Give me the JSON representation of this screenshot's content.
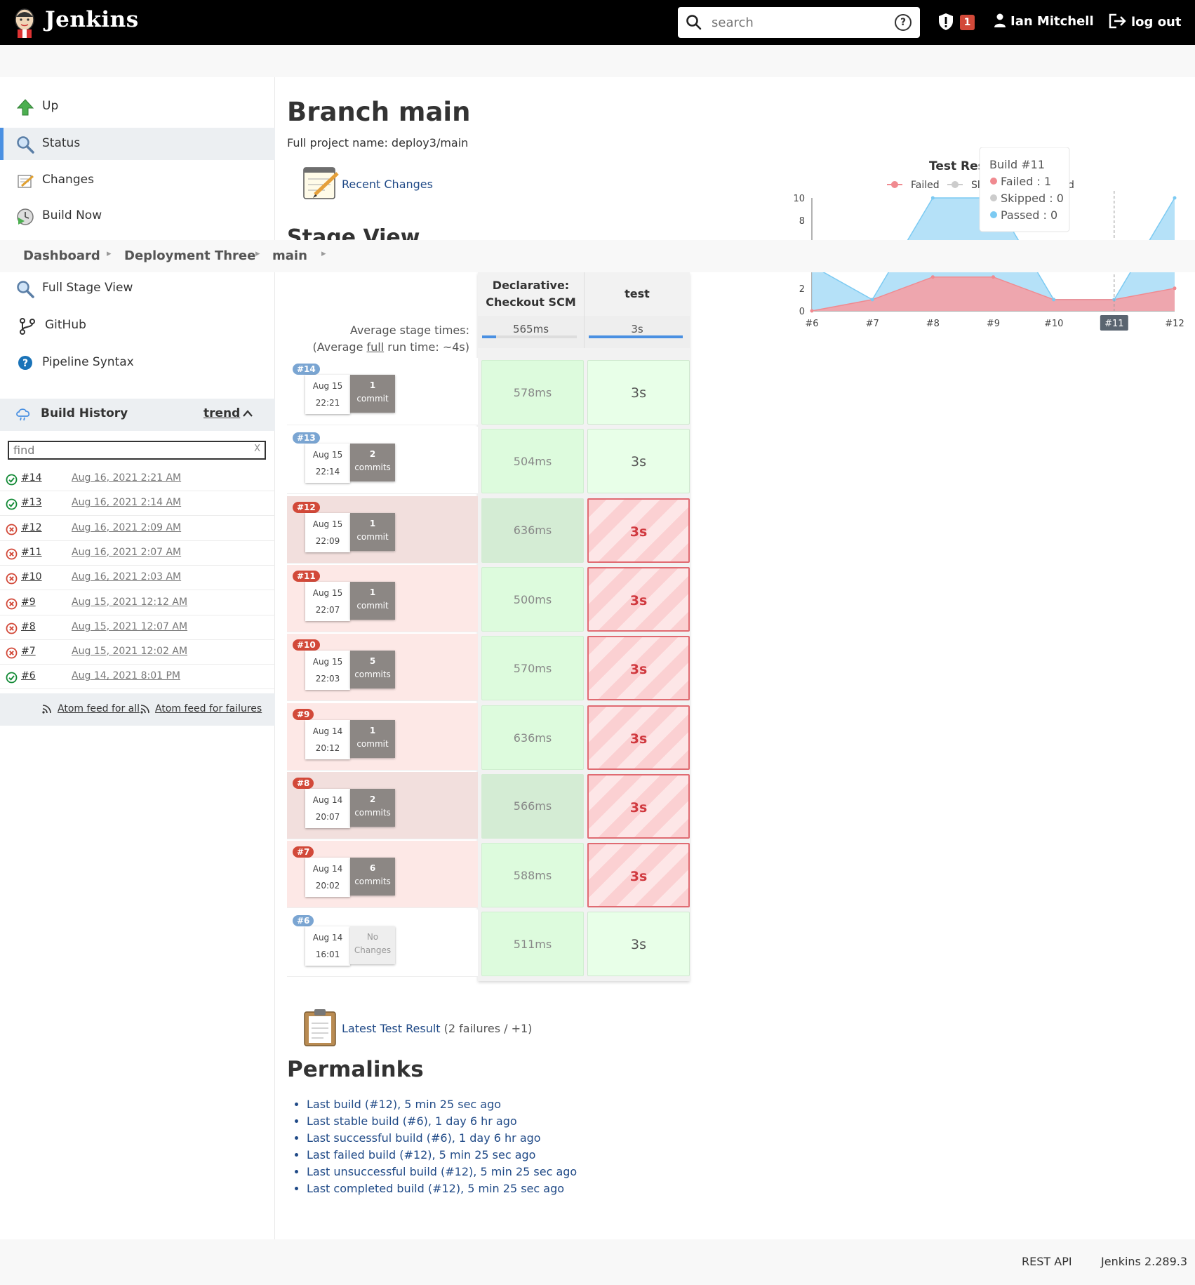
{
  "header": {
    "brand": "Jenkins",
    "search_placeholder": "search",
    "security_count": "1",
    "user_name": "Ian Mitchell",
    "logout_label": "log out"
  },
  "sidebar": {
    "tasks": [
      {
        "label": "Up",
        "icon": "up-arrow-icon"
      },
      {
        "label": "Status",
        "icon": "magnifier-icon"
      },
      {
        "label": "Changes",
        "icon": "notepad-icon"
      },
      {
        "label": "Build Now",
        "icon": "clock-play-icon"
      },
      {
        "label": "Full Stage View",
        "icon": "magnifier-icon"
      },
      {
        "label": "GitHub",
        "icon": "git-branch-icon"
      },
      {
        "label": "Pipeline Syntax",
        "icon": "help-icon"
      }
    ],
    "build_history": {
      "title": "Build History",
      "trend_label": "trend",
      "find_placeholder": "find",
      "clear_label": "X",
      "builds": [
        {
          "number": "#14",
          "date": "Aug 16, 2021 2:21 AM",
          "status": "success"
        },
        {
          "number": "#13",
          "date": "Aug 16, 2021 2:14 AM",
          "status": "success"
        },
        {
          "number": "#12",
          "date": "Aug 16, 2021 2:09 AM",
          "status": "failed"
        },
        {
          "number": "#11",
          "date": "Aug 16, 2021 2:07 AM",
          "status": "failed"
        },
        {
          "number": "#10",
          "date": "Aug 16, 2021 2:03 AM",
          "status": "failed"
        },
        {
          "number": "#9",
          "date": "Aug 15, 2021 12:12 AM",
          "status": "failed"
        },
        {
          "number": "#8",
          "date": "Aug 15, 2021 12:07 AM",
          "status": "failed"
        },
        {
          "number": "#7",
          "date": "Aug 15, 2021 12:02 AM",
          "status": "failed"
        },
        {
          "number": "#6",
          "date": "Aug 14, 2021 8:01 PM",
          "status": "success"
        }
      ],
      "atom_all": "Atom feed for all",
      "atom_failures": "Atom feed for failures"
    }
  },
  "breadcrumbs": [
    "Dashboard",
    "Deployment Three",
    "main"
  ],
  "main": {
    "title": "Branch main",
    "full_name": "Full project name: deploy3/main",
    "recent_changes": "Recent Changes",
    "stage_view_title": "Stage View",
    "latest_test_link": "Latest Test Result",
    "latest_test_suffix": " (2 failures / +1)",
    "permalinks_title": "Permalinks",
    "permalinks": [
      "Last build (#12), 5 min 25 sec ago",
      "Last stable build (#6), 1 day 6 hr ago",
      "Last successful build (#6), 1 day 6 hr ago",
      "Last failed build (#12), 5 min 25 sec ago",
      "Last unsuccessful build (#12), 5 min 25 sec ago",
      "Last completed build (#12), 5 min 25 sec ago"
    ]
  },
  "stage_view": {
    "stages": [
      "Declarative: Checkout SCM",
      "test"
    ],
    "avg_label": "Average stage times:",
    "avg_full_prefix": "(Average ",
    "avg_full_link": "full",
    "avg_full_suffix": " run time: ~4s)",
    "avg_times": [
      "565ms",
      "3s"
    ],
    "avg_fill": [
      0.15,
      1.0
    ],
    "failed_label": "failed",
    "runs": [
      {
        "badge": "#14",
        "date": "Aug 15",
        "time": "22:21",
        "commits_n": "1",
        "commits_w": "commit",
        "cells": [
          "578ms",
          "3s"
        ],
        "status": "success",
        "highlight": false
      },
      {
        "badge": "#13",
        "date": "Aug 15",
        "time": "22:14",
        "commits_n": "2",
        "commits_w": "commits",
        "cells": [
          "504ms",
          "3s"
        ],
        "status": "success",
        "highlight": false
      },
      {
        "badge": "#12",
        "date": "Aug 15",
        "time": "22:09",
        "commits_n": "1",
        "commits_w": "commit",
        "cells": [
          "636ms",
          "3s"
        ],
        "status": "failed",
        "highlight": true
      },
      {
        "badge": "#11",
        "date": "Aug 15",
        "time": "22:07",
        "commits_n": "1",
        "commits_w": "commit",
        "cells": [
          "500ms",
          "3s"
        ],
        "status": "failed",
        "highlight": false
      },
      {
        "badge": "#10",
        "date": "Aug 15",
        "time": "22:03",
        "commits_n": "5",
        "commits_w": "commits",
        "cells": [
          "570ms",
          "3s"
        ],
        "status": "failed",
        "highlight": false
      },
      {
        "badge": "#9",
        "date": "Aug 14",
        "time": "20:12",
        "commits_n": "1",
        "commits_w": "commit",
        "cells": [
          "636ms",
          "3s"
        ],
        "status": "failed",
        "highlight": false
      },
      {
        "badge": "#8",
        "date": "Aug 14",
        "time": "20:07",
        "commits_n": "2",
        "commits_w": "commits",
        "cells": [
          "566ms",
          "3s"
        ],
        "status": "failed",
        "highlight": true
      },
      {
        "badge": "#7",
        "date": "Aug 14",
        "time": "20:02",
        "commits_n": "6",
        "commits_w": "commits",
        "cells": [
          "588ms",
          "3s"
        ],
        "status": "failed",
        "highlight": false
      },
      {
        "badge": "#6",
        "date": "Aug 14",
        "time": "16:01",
        "commits_n": "No",
        "commits_w": "Changes",
        "cells": [
          "511ms",
          "3s"
        ],
        "status": "success",
        "highlight": false
      }
    ]
  },
  "chart_data": {
    "type": "area",
    "title": "Test Resu",
    "legend": [
      "Failed",
      "Sk",
      "d"
    ],
    "legend_position": "top",
    "categories": [
      "#6",
      "#7",
      "#8",
      "#9",
      "#10",
      "#11",
      "#12"
    ],
    "series": [
      {
        "name": "Failed",
        "values": [
          0,
          1,
          3,
          3,
          1,
          1,
          2
        ],
        "color": "#f4a0a5"
      },
      {
        "name": "Passed",
        "values": [
          4,
          1,
          10,
          10,
          1,
          1,
          10
        ],
        "color": "#a8dcf7"
      }
    ],
    "ylim": [
      0,
      10
    ],
    "yticks": [
      "0",
      "2",
      "8",
      "10"
    ],
    "highlighted": "#11",
    "tooltip": {
      "title": "Build #11",
      "failed": "Failed : 1",
      "skipped": "Skipped : 0",
      "passed": "Passed : 0"
    }
  },
  "footer": {
    "rest_api": "REST API",
    "version": "Jenkins 2.289.3"
  }
}
